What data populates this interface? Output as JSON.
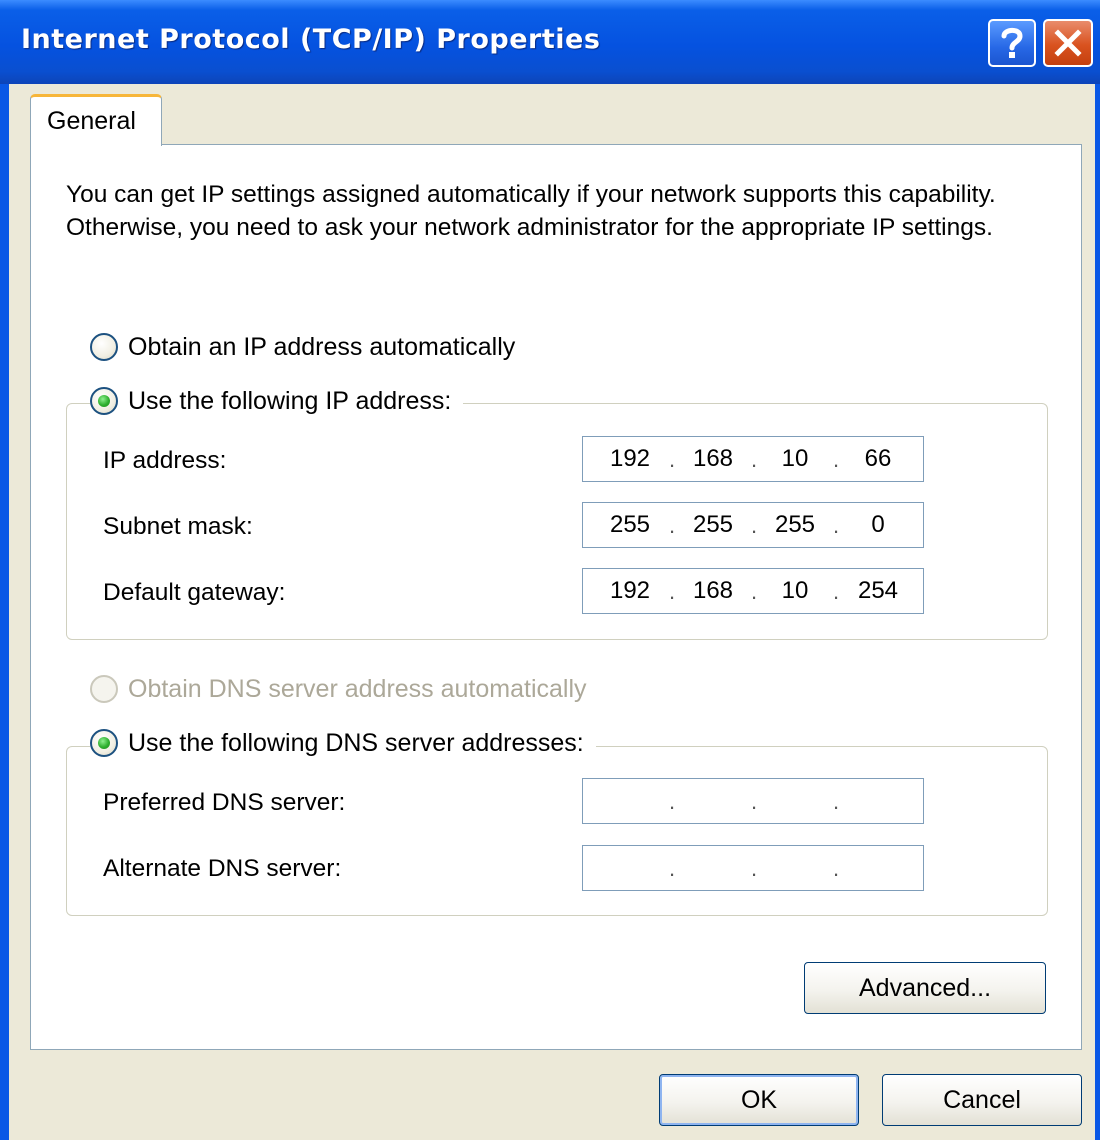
{
  "window": {
    "title": "Internet Protocol (TCP/IP) Properties",
    "help_icon": "question-mark-icon",
    "close_icon": "close-x-icon"
  },
  "tabs": [
    {
      "label": "General",
      "selected": true
    }
  ],
  "description": "You can get IP settings assigned automatically if your network supports this capability. Otherwise, you need to ask your network administrator for the appropriate IP settings.",
  "ip_mode": {
    "auto_label": "Obtain an IP address automatically",
    "auto_checked": false,
    "manual_label": "Use the following IP address:",
    "manual_checked": true
  },
  "ip_fields": {
    "ip_address": {
      "label": "IP address:",
      "octets": [
        "192",
        "168",
        "10",
        "66"
      ]
    },
    "subnet_mask": {
      "label": "Subnet mask:",
      "octets": [
        "255",
        "255",
        "255",
        "0"
      ]
    },
    "default_gateway": {
      "label": "Default gateway:",
      "octets": [
        "192",
        "168",
        "10",
        "254"
      ]
    }
  },
  "dns_mode": {
    "auto_label": "Obtain DNS server address automatically",
    "auto_checked": false,
    "auto_disabled": true,
    "manual_label": "Use the following DNS server addresses:",
    "manual_checked": true
  },
  "dns_fields": {
    "preferred": {
      "label": "Preferred DNS server:",
      "octets": [
        "",
        "",
        "",
        ""
      ]
    },
    "alternate": {
      "label": "Alternate DNS server:",
      "octets": [
        "",
        "",
        "",
        ""
      ]
    }
  },
  "buttons": {
    "advanced": "Advanced...",
    "ok": "OK",
    "cancel": "Cancel"
  },
  "colors": {
    "titlebar": "#0552e0",
    "dialog_bg": "#ece9d8",
    "tab_highlight": "#f7b63a",
    "radio_checked": "#2fb02f",
    "close_button": "#d9521f",
    "disabled_text": "#aca899"
  }
}
